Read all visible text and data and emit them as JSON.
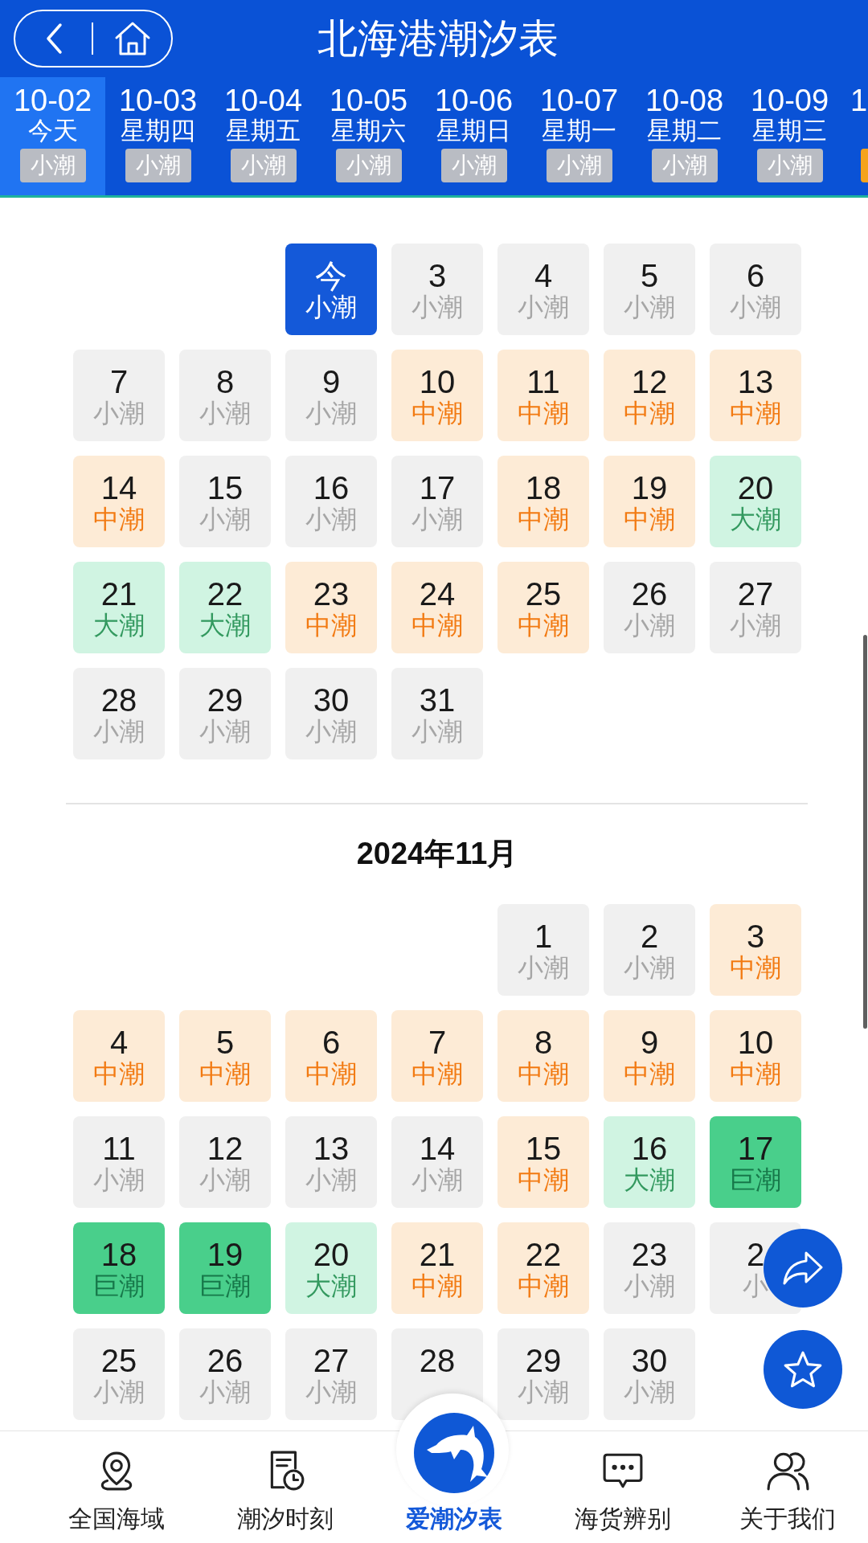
{
  "header": {
    "title": "北海港潮汐表"
  },
  "date_tabs": [
    {
      "date": "10-02",
      "day": "今天",
      "tide": "小潮",
      "kind": "small",
      "selected": true
    },
    {
      "date": "10-03",
      "day": "星期四",
      "tide": "小潮",
      "kind": "small",
      "selected": false
    },
    {
      "date": "10-04",
      "day": "星期五",
      "tide": "小潮",
      "kind": "small",
      "selected": false
    },
    {
      "date": "10-05",
      "day": "星期六",
      "tide": "小潮",
      "kind": "small",
      "selected": false
    },
    {
      "date": "10-06",
      "day": "星期日",
      "tide": "小潮",
      "kind": "small",
      "selected": false
    },
    {
      "date": "10-07",
      "day": "星期一",
      "tide": "小潮",
      "kind": "small",
      "selected": false
    },
    {
      "date": "10-08",
      "day": "星期二",
      "tide": "小潮",
      "kind": "small",
      "selected": false
    },
    {
      "date": "10-09",
      "day": "星期三",
      "tide": "小潮",
      "kind": "small",
      "selected": false
    },
    {
      "date": "1",
      "kind": "medium",
      "selected": false
    }
  ],
  "months": [
    {
      "weeks": [
        [
          {
            "day": "今",
            "tide": "小潮",
            "kind": "small",
            "selected": true
          },
          {
            "day": "3",
            "tide": "小潮",
            "kind": "small",
            "selected": false
          },
          {
            "day": "4",
            "tide": "小潮",
            "kind": "small",
            "selected": false
          },
          {
            "day": "5",
            "tide": "小潮",
            "kind": "small",
            "selected": false
          },
          {
            "day": "6",
            "tide": "小潮",
            "kind": "small",
            "selected": false
          }
        ],
        [
          {
            "day": "7",
            "tide": "小潮",
            "kind": "small",
            "selected": false
          },
          {
            "day": "8",
            "tide": "小潮",
            "kind": "small",
            "selected": false
          },
          {
            "day": "9",
            "tide": "小潮",
            "kind": "small",
            "selected": false
          },
          {
            "day": "10",
            "tide": "中潮",
            "kind": "medium",
            "selected": false
          },
          {
            "day": "11",
            "tide": "中潮",
            "kind": "medium",
            "selected": false
          },
          {
            "day": "12",
            "tide": "中潮",
            "kind": "medium",
            "selected": false
          },
          {
            "day": "13",
            "tide": "中潮",
            "kind": "medium",
            "selected": false
          }
        ],
        [
          {
            "day": "14",
            "tide": "中潮",
            "kind": "medium",
            "selected": false
          },
          {
            "day": "15",
            "tide": "小潮",
            "kind": "small",
            "selected": false
          },
          {
            "day": "16",
            "tide": "小潮",
            "kind": "small",
            "selected": false
          },
          {
            "day": "17",
            "tide": "小潮",
            "kind": "small",
            "selected": false
          },
          {
            "day": "18",
            "tide": "中潮",
            "kind": "medium",
            "selected": false
          },
          {
            "day": "19",
            "tide": "中潮",
            "kind": "medium",
            "selected": false
          },
          {
            "day": "20",
            "tide": "大潮",
            "kind": "big",
            "selected": false
          }
        ],
        [
          {
            "day": "21",
            "tide": "大潮",
            "kind": "big",
            "selected": false
          },
          {
            "day": "22",
            "tide": "大潮",
            "kind": "big",
            "selected": false
          },
          {
            "day": "23",
            "tide": "中潮",
            "kind": "medium",
            "selected": false
          },
          {
            "day": "24",
            "tide": "中潮",
            "kind": "medium",
            "selected": false
          },
          {
            "day": "25",
            "tide": "中潮",
            "kind": "medium",
            "selected": false
          },
          {
            "day": "26",
            "tide": "小潮",
            "kind": "small",
            "selected": false
          },
          {
            "day": "27",
            "tide": "小潮",
            "kind": "small",
            "selected": false
          }
        ],
        [
          {
            "day": "28",
            "tide": "小潮",
            "kind": "small",
            "selected": false
          },
          {
            "day": "29",
            "tide": "小潮",
            "kind": "small",
            "selected": false
          },
          {
            "day": "30",
            "tide": "小潮",
            "kind": "small",
            "selected": false
          },
          {
            "day": "31",
            "tide": "小潮",
            "kind": "small",
            "selected": false
          }
        ]
      ]
    },
    {
      "title": "2024年11月",
      "weeks": [
        [
          {
            "day": "1",
            "tide": "小潮",
            "kind": "small",
            "selected": false
          },
          {
            "day": "2",
            "tide": "小潮",
            "kind": "small",
            "selected": false
          },
          {
            "day": "3",
            "tide": "中潮",
            "kind": "medium",
            "selected": false
          }
        ],
        [
          {
            "day": "4",
            "tide": "中潮",
            "kind": "medium",
            "selected": false
          },
          {
            "day": "5",
            "tide": "中潮",
            "kind": "medium",
            "selected": false
          },
          {
            "day": "6",
            "tide": "中潮",
            "kind": "medium",
            "selected": false
          },
          {
            "day": "7",
            "tide": "中潮",
            "kind": "medium",
            "selected": false
          },
          {
            "day": "8",
            "tide": "中潮",
            "kind": "medium",
            "selected": false
          },
          {
            "day": "9",
            "tide": "中潮",
            "kind": "medium",
            "selected": false
          },
          {
            "day": "10",
            "tide": "中潮",
            "kind": "medium",
            "selected": false
          }
        ],
        [
          {
            "day": "11",
            "tide": "小潮",
            "kind": "small",
            "selected": false
          },
          {
            "day": "12",
            "tide": "小潮",
            "kind": "small",
            "selected": false
          },
          {
            "day": "13",
            "tide": "小潮",
            "kind": "small",
            "selected": false
          },
          {
            "day": "14",
            "tide": "小潮",
            "kind": "small",
            "selected": false
          },
          {
            "day": "15",
            "tide": "中潮",
            "kind": "medium",
            "selected": false
          },
          {
            "day": "16",
            "tide": "大潮",
            "kind": "big",
            "selected": false
          },
          {
            "day": "17",
            "tide": "巨潮",
            "kind": "huge",
            "selected": false
          }
        ],
        [
          {
            "day": "18",
            "tide": "巨潮",
            "kind": "huge",
            "selected": false
          },
          {
            "day": "19",
            "tide": "巨潮",
            "kind": "huge",
            "selected": false
          },
          {
            "day": "20",
            "tide": "大潮",
            "kind": "big",
            "selected": false
          },
          {
            "day": "21",
            "tide": "中潮",
            "kind": "medium",
            "selected": false
          },
          {
            "day": "22",
            "tide": "中潮",
            "kind": "medium",
            "selected": false
          },
          {
            "day": "23",
            "tide": "小潮",
            "kind": "small",
            "selected": false
          },
          {
            "day": "2",
            "tide": "小",
            "kind": "small",
            "selected": false
          }
        ],
        [
          {
            "day": "25",
            "tide": "小潮",
            "kind": "small",
            "selected": false
          },
          {
            "day": "26",
            "tide": "小潮",
            "kind": "small",
            "selected": false
          },
          {
            "day": "27",
            "tide": "小潮",
            "kind": "small",
            "selected": false
          },
          {
            "day": "28",
            "kind": "small",
            "selected": false
          },
          {
            "day": "29",
            "tide": "小潮",
            "kind": "small",
            "selected": false
          },
          {
            "day": "30",
            "tide": "小潮",
            "kind": "small",
            "selected": false
          }
        ]
      ]
    }
  ],
  "bottom_nav": [
    {
      "label": "全国海域",
      "selected": false
    },
    {
      "label": "潮汐时刻",
      "selected": false
    },
    {
      "label": "爱潮汐表",
      "selected": true
    },
    {
      "label": "海货辨别",
      "selected": false
    },
    {
      "label": "关于我们",
      "selected": false
    }
  ]
}
